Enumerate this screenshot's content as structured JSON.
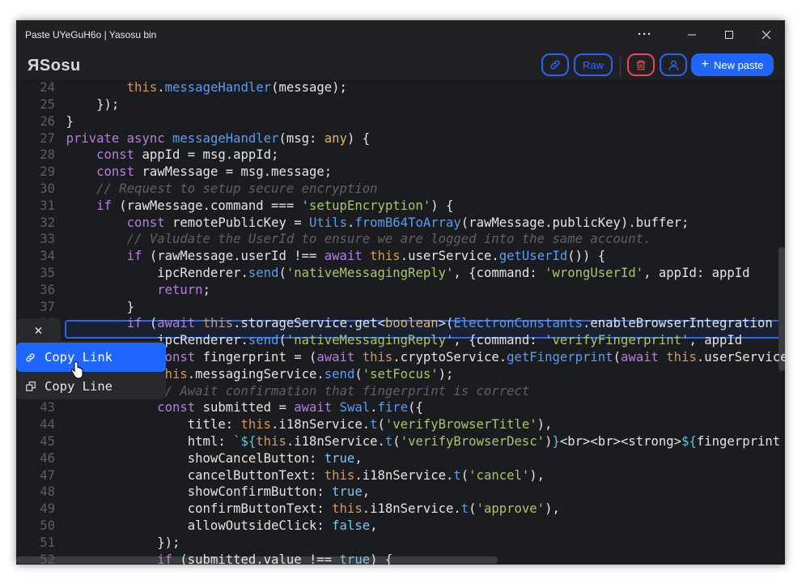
{
  "window": {
    "title": "Paste UYeGuH6o | Yasosu bin",
    "more_icon": "ellipsis-icon",
    "minimize_icon": "minimize-icon",
    "maximize_icon": "maximize-icon",
    "close_icon": "close-icon"
  },
  "header": {
    "logo": "ЯSosu",
    "link_icon": "link-icon",
    "raw_label": "Raw",
    "delete_icon": "trash-icon",
    "user_icon": "user-icon",
    "new_paste_label": "New paste",
    "colors": {
      "accent": "#1f66ff",
      "danger": "#ef4452"
    }
  },
  "editor": {
    "highlighted_line": 35,
    "lines": [
      {
        "n": "24",
        "i": 12,
        "t": [
          [
            "th",
            "this"
          ],
          [
            "",
            "."
          ],
          [
            "fn",
            "messageHandler"
          ],
          [
            "",
            "(message);"
          ]
        ]
      },
      {
        "n": "25",
        "i": 8,
        "t": [
          [
            "",
            "});"
          ]
        ]
      },
      {
        "n": "26",
        "i": 4,
        "t": [
          [
            "",
            "}"
          ]
        ]
      },
      {
        "n": "27",
        "i": 4,
        "t": [
          [
            "kw",
            "private async "
          ],
          [
            "fn",
            "messageHandler"
          ],
          [
            "",
            "(msg: "
          ],
          [
            "ty",
            "any"
          ],
          [
            "",
            ") {"
          ]
        ]
      },
      {
        "n": "28",
        "i": 8,
        "t": [
          [
            "kw",
            "const "
          ],
          [
            "",
            "appId = msg.appId;"
          ]
        ]
      },
      {
        "n": "29",
        "i": 8,
        "t": [
          [
            "kw",
            "const "
          ],
          [
            "",
            "rawMessage = msg.message;"
          ]
        ]
      },
      {
        "n": "30",
        "i": 8,
        "t": [
          [
            "cm",
            "// Request to setup secure encryption"
          ]
        ]
      },
      {
        "n": "31",
        "i": 8,
        "t": [
          [
            "kw",
            "if "
          ],
          [
            "",
            "(rawMessage.command === "
          ],
          [
            "str",
            "'setupEncryption'"
          ],
          [
            "",
            ") {"
          ]
        ]
      },
      {
        "n": "32",
        "i": 12,
        "t": [
          [
            "kw",
            "const "
          ],
          [
            "",
            "remotePublicKey = "
          ],
          [
            "fn",
            "Utils"
          ],
          [
            "",
            "."
          ],
          [
            "fn",
            "fromB64ToArray"
          ],
          [
            "",
            "(rawMessage.publicKey).buffer;"
          ]
        ]
      },
      {
        "n": "33",
        "i": 12,
        "t": [
          [
            "cm",
            "// Valudate the UserId to ensure we are logged into the same account."
          ]
        ]
      },
      {
        "n": "34",
        "i": 12,
        "t": [
          [
            "kw",
            "if "
          ],
          [
            "",
            "(rawMessage.userId !== "
          ],
          [
            "kw",
            "await "
          ],
          [
            "th",
            "this"
          ],
          [
            "",
            ".userService."
          ],
          [
            "fn",
            "getUserId"
          ],
          [
            "",
            "()) {"
          ]
        ]
      },
      {
        "n": "35",
        "i": 16,
        "t": [
          [
            "",
            "ipcRenderer."
          ],
          [
            "fn",
            "send"
          ],
          [
            "",
            "("
          ],
          [
            "str",
            "'nativeMessagingReply'"
          ],
          [
            "",
            ", {command: "
          ],
          [
            "str",
            "'wrongUserId'"
          ],
          [
            "",
            ", appId: appId"
          ]
        ]
      },
      {
        "n": "36",
        "i": 16,
        "t": [
          [
            "kw",
            "return"
          ],
          [
            "",
            ";"
          ]
        ]
      },
      {
        "n": "37",
        "i": 12,
        "t": [
          [
            "",
            "}"
          ]
        ]
      },
      {
        "n": "38",
        "i": 12,
        "t": [
          [
            "kw",
            "if "
          ],
          [
            "",
            "("
          ],
          [
            "kw",
            "await "
          ],
          [
            "th",
            "this"
          ],
          [
            "",
            ".storageService.get<"
          ],
          [
            "ty",
            "boolean"
          ],
          [
            "",
            ">("
          ],
          [
            "fn",
            "ElectronConstants"
          ],
          [
            "",
            ".enableBrowserIntegration"
          ]
        ]
      },
      {
        "n": "39",
        "i": 16,
        "t": [
          [
            "",
            "ipcRenderer."
          ],
          [
            "fn",
            "send"
          ],
          [
            "",
            "("
          ],
          [
            "str",
            "'nativeMessagingReply'"
          ],
          [
            "",
            ", {command: "
          ],
          [
            "str",
            "'verifyFingerprint'"
          ],
          [
            "",
            ", appId"
          ]
        ]
      },
      {
        "n": "40",
        "i": 16,
        "t": [
          [
            "kw",
            "const "
          ],
          [
            "",
            "fingerprint = ("
          ],
          [
            "kw",
            "await "
          ],
          [
            "th",
            "this"
          ],
          [
            "",
            ".cryptoService."
          ],
          [
            "fn",
            "getFingerprint"
          ],
          [
            "",
            "("
          ],
          [
            "kw",
            "await "
          ],
          [
            "th",
            "this"
          ],
          [
            "",
            ".userService"
          ]
        ]
      },
      {
        "n": "41",
        "i": 16,
        "t": [
          [
            "th",
            "this"
          ],
          [
            "",
            ".messagingService."
          ],
          [
            "fn",
            "send"
          ],
          [
            "",
            "("
          ],
          [
            "str",
            "'setFocus'"
          ],
          [
            "",
            ");"
          ]
        ]
      },
      {
        "n": "42",
        "i": 16,
        "t": [
          [
            "cm",
            "// Await confirmation that fingerprint is correct"
          ]
        ]
      },
      {
        "n": "43",
        "i": 16,
        "t": [
          [
            "kw",
            "const "
          ],
          [
            "",
            "submitted = "
          ],
          [
            "kw",
            "await "
          ],
          [
            "fn",
            "Swal"
          ],
          [
            "",
            "."
          ],
          [
            "fn",
            "fire"
          ],
          [
            "",
            "({"
          ]
        ]
      },
      {
        "n": "44",
        "i": 20,
        "t": [
          [
            "",
            "title: "
          ],
          [
            "th",
            "this"
          ],
          [
            "",
            ".i18nService."
          ],
          [
            "fn",
            "t"
          ],
          [
            "",
            "("
          ],
          [
            "str",
            "'verifyBrowserTitle'"
          ],
          [
            "",
            "),"
          ]
        ]
      },
      {
        "n": "45",
        "i": 20,
        "t": [
          [
            "",
            "html: "
          ],
          [
            "tp",
            "`${"
          ],
          [
            "th",
            "this"
          ],
          [
            "",
            ".i18nService."
          ],
          [
            "fn",
            "t"
          ],
          [
            "",
            "("
          ],
          [
            "str",
            "'verifyBrowserDesc'"
          ],
          [
            "",
            ")"
          ],
          [
            "tp",
            "}"
          ],
          [
            "",
            "<br><br><strong>"
          ],
          [
            "tp",
            "${"
          ],
          [
            "",
            "fingerprint"
          ]
        ]
      },
      {
        "n": "46",
        "i": 20,
        "t": [
          [
            "",
            "showCancelButton: "
          ],
          [
            "bo",
            "true"
          ],
          [
            "",
            ","
          ]
        ]
      },
      {
        "n": "47",
        "i": 20,
        "t": [
          [
            "",
            "cancelButtonText: "
          ],
          [
            "th",
            "this"
          ],
          [
            "",
            ".i18nService."
          ],
          [
            "fn",
            "t"
          ],
          [
            "",
            "("
          ],
          [
            "str",
            "'cancel'"
          ],
          [
            "",
            "),"
          ]
        ]
      },
      {
        "n": "48",
        "i": 20,
        "t": [
          [
            "",
            "showConfirmButton: "
          ],
          [
            "bo",
            "true"
          ],
          [
            "",
            ","
          ]
        ]
      },
      {
        "n": "49",
        "i": 20,
        "t": [
          [
            "",
            "confirmButtonText: "
          ],
          [
            "th",
            "this"
          ],
          [
            "",
            ".i18nService."
          ],
          [
            "fn",
            "t"
          ],
          [
            "",
            "("
          ],
          [
            "str",
            "'approve'"
          ],
          [
            "",
            "),"
          ]
        ]
      },
      {
        "n": "50",
        "i": 20,
        "t": [
          [
            "",
            "allowOutsideClick: "
          ],
          [
            "bo",
            "false"
          ],
          [
            "",
            ","
          ]
        ]
      },
      {
        "n": "51",
        "i": 16,
        "t": [
          [
            "",
            "});"
          ]
        ]
      },
      {
        "n": "52",
        "i": 16,
        "t": [
          [
            "kw",
            "if "
          ],
          [
            "",
            "(submitted.value !== "
          ],
          [
            "bo",
            "true"
          ],
          [
            "",
            ") {"
          ]
        ]
      }
    ]
  },
  "context_menu": {
    "close_icon": "close-icon",
    "items": [
      {
        "label": "Copy Link",
        "icon": "link-icon",
        "active": true
      },
      {
        "label": "Copy Line",
        "icon": "copy-icon",
        "active": false
      }
    ]
  }
}
